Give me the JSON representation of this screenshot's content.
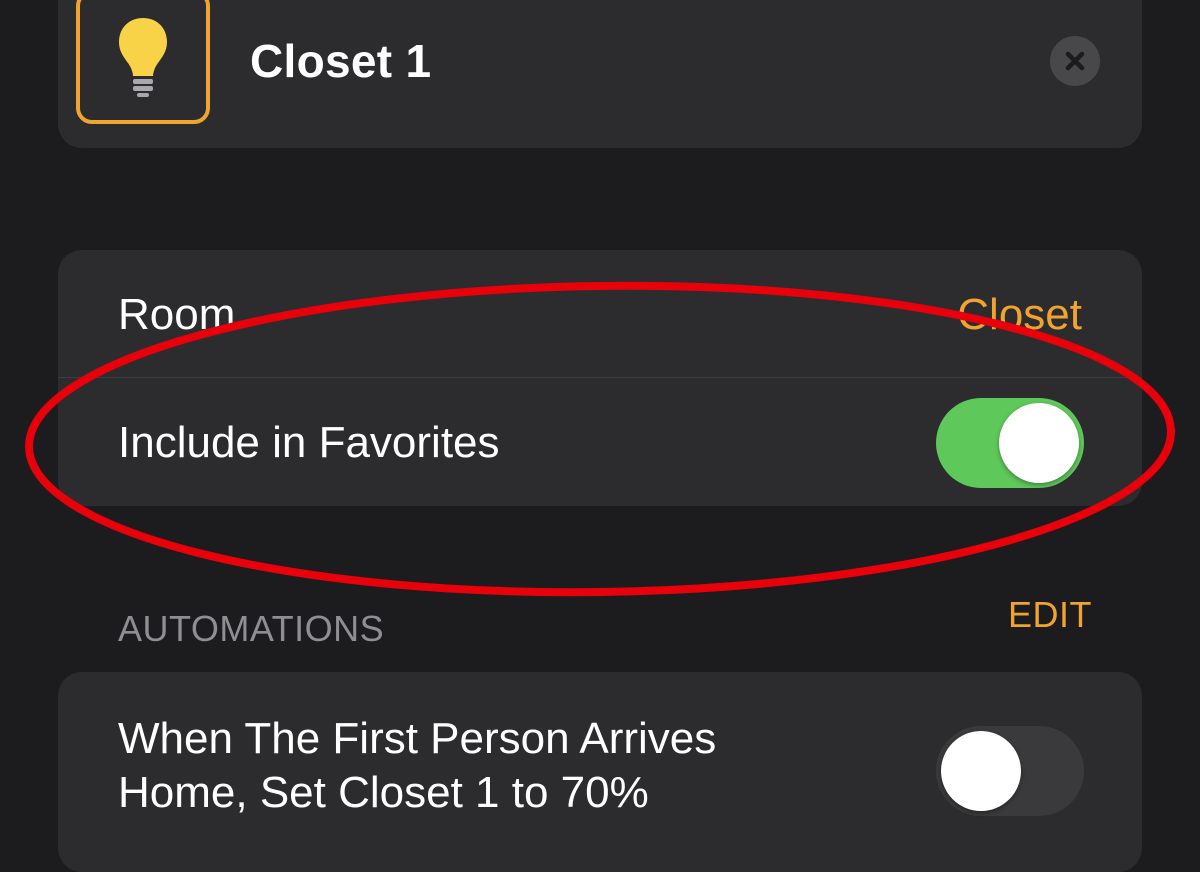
{
  "accessory": {
    "name": "Closet 1",
    "icon": "lightbulb-icon",
    "tile_border_color": "#f0a32e",
    "bulb_color": "#f8d347"
  },
  "settings": {
    "room_label": "Room",
    "room_value": "Closet",
    "favorites_label": "Include in Favorites",
    "favorites_on": true
  },
  "automations": {
    "header": "AUTOMATIONS",
    "edit_label": "EDIT",
    "items": [
      {
        "text": "When The First Person Arrives Home, Set Closet 1 to 70%",
        "enabled": false
      }
    ]
  },
  "colors": {
    "background": "#1c1c1e",
    "card": "#2c2c2e",
    "accent": "#f0a32e",
    "toggle_on": "#5fc85a",
    "toggle_off": "#3a3a3c",
    "annotation": "#e8000a"
  }
}
